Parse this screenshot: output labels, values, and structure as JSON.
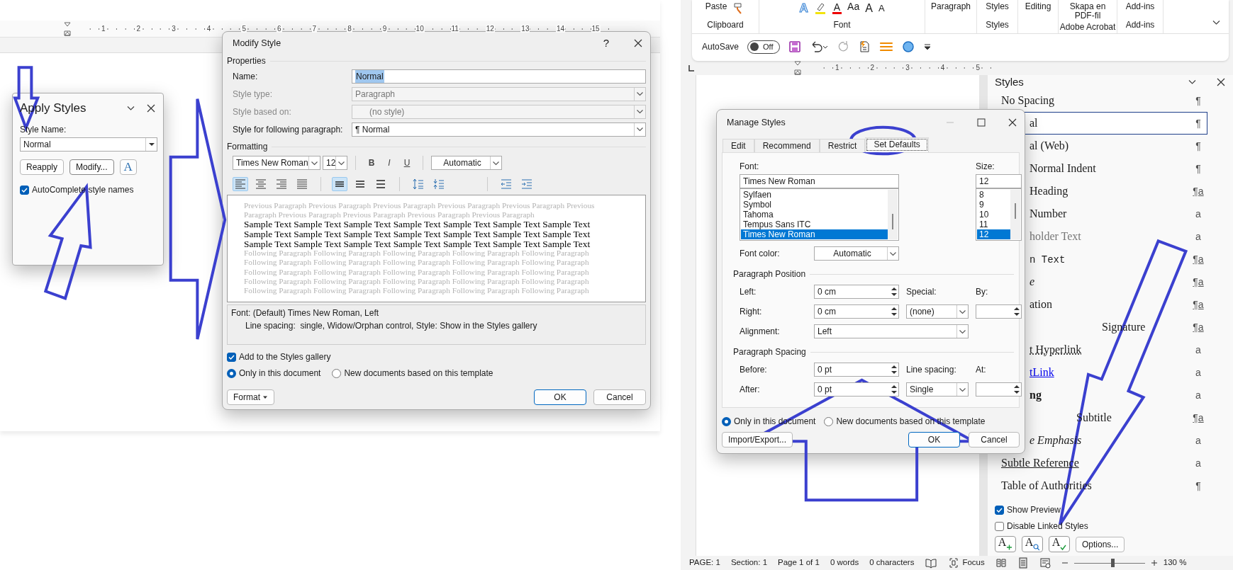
{
  "left_view": {
    "ruler_numbers": [
      "1",
      "2",
      "3",
      "4",
      "5",
      "6",
      "7",
      "8",
      "9",
      "10",
      "11",
      "12",
      "13",
      "14",
      "15"
    ]
  },
  "apply_styles": {
    "title": "Apply Styles",
    "style_name_label": "Style Name:",
    "style_name_value": "Normal",
    "buttons": [
      "Reapply",
      "Modify..."
    ],
    "inspector_letter": "A",
    "autocomplete": {
      "label": "AutoComplete style names",
      "checked": true
    }
  },
  "modify_style": {
    "title": "Modify Style",
    "help": "?",
    "properties_heading": "Properties",
    "fields": [
      {
        "label": "Name:",
        "value": "Normal",
        "kind": "text",
        "disabled": false,
        "highlighted": true
      },
      {
        "label": "Style type:",
        "value": "Paragraph",
        "kind": "select",
        "disabled": true
      },
      {
        "label": "Style based on:",
        "value": "(no style)",
        "kind": "select",
        "disabled": true
      },
      {
        "label": "Style for following paragraph:",
        "value": "¶ Normal",
        "kind": "select",
        "disabled": false
      }
    ],
    "formatting_heading": "Formatting",
    "font": "Times New Roman",
    "size": "12",
    "text_buttons": [
      "B",
      "I",
      "U"
    ],
    "color_choice": "Automatic",
    "paragraph_buttons": [
      {
        "kind": "align-left",
        "selected": true
      },
      {
        "kind": "align-center",
        "selected": false
      },
      {
        "kind": "align-right",
        "selected": false
      },
      {
        "kind": "justify",
        "selected": false
      },
      {
        "kind": "single",
        "selected": true
      },
      {
        "kind": "one-half",
        "selected": false
      },
      {
        "kind": "double",
        "selected": false
      },
      {
        "kind": "space-up",
        "selected": false
      },
      {
        "kind": "space-down",
        "selected": false
      },
      {
        "kind": "outdent",
        "selected": false
      },
      {
        "kind": "indent",
        "selected": false
      }
    ],
    "preview": [
      {
        "kind": "previous",
        "text": "Previous Paragraph Previous Paragraph Previous Paragraph Previous Paragraph Previous Paragraph Previous"
      },
      {
        "kind": "previous",
        "text": "Paragraph Previous Paragraph Previous Paragraph Previous Paragraph Previous Paragraph"
      },
      {
        "kind": "sample",
        "text": "Sample Text Sample Text Sample Text Sample Text Sample Text Sample Text Sample Text"
      },
      {
        "kind": "sample",
        "text": "Sample Text Sample Text Sample Text Sample Text Sample Text Sample Text Sample Text"
      },
      {
        "kind": "sample",
        "text": "Sample Text Sample Text Sample Text Sample Text Sample Text Sample Text Sample Text"
      },
      {
        "kind": "following",
        "text": "Following Paragraph Following Paragraph Following Paragraph Following Paragraph Following Paragraph"
      },
      {
        "kind": "following",
        "text": "Following Paragraph Following Paragraph Following Paragraph Following Paragraph Following Paragraph"
      },
      {
        "kind": "following",
        "text": "Following Paragraph Following Paragraph Following Paragraph Following Paragraph Following Paragraph"
      },
      {
        "kind": "following",
        "text": "Following Paragraph Following Paragraph Following Paragraph Following Paragraph Following Paragraph"
      },
      {
        "kind": "following",
        "text": "Following Paragraph Following Paragraph Following Paragraph Following Paragraph Following Paragraph"
      }
    ],
    "description": [
      "Font: (Default) Times New Roman, Left",
      "Line spacing:  single, Widow/Orphan control, Style: Show in the Styles gallery"
    ],
    "add_to_gallery": {
      "label": "Add to the Styles gallery",
      "checked": true
    },
    "scope": [
      {
        "label": "Only in this document",
        "selected": true
      },
      {
        "label": "New documents based on this template",
        "selected": false
      }
    ],
    "format_button": "Format",
    "ok": "OK",
    "cancel": "Cancel"
  },
  "ribbon": {
    "groups": [
      {
        "label": "Clipboard",
        "buttons": [
          "Paste"
        ]
      },
      {
        "label": "Font",
        "buttons": [
          "Aa"
        ],
        "letters": [
          "A",
          "A",
          "A",
          "A"
        ]
      },
      {
        "buttons": [
          "Paragraph"
        ]
      },
      {
        "label": "Styles",
        "buttons": [
          "Styles"
        ]
      },
      {
        "buttons": [
          "Editing"
        ]
      },
      {
        "label": "Adobe Acrobat",
        "buttons": [
          "Skapa en PDF-fil"
        ]
      },
      {
        "label": "Add-ins",
        "buttons": [
          "Add-ins"
        ]
      }
    ],
    "autosave_label": "AutoSave",
    "autosave": {
      "on": false,
      "label": "Off"
    }
  },
  "right_ruler_numbers": [
    "1",
    "2",
    "3",
    "4",
    "5"
  ],
  "manage_styles": {
    "title": "Manage Styles",
    "tabs": [
      {
        "label": "Edit",
        "selected": false
      },
      {
        "label": "Recommend",
        "selected": false
      },
      {
        "label": "Restrict",
        "selected": false
      },
      {
        "label": "Set Defaults",
        "selected": true
      }
    ],
    "font_label": "Font:",
    "font_value": "Times New Roman",
    "fonts": [
      {
        "label": "Sylfaen",
        "selected": false
      },
      {
        "label": "Symbol",
        "selected": false
      },
      {
        "label": "Tahoma",
        "selected": false
      },
      {
        "label": "Tempus Sans ITC",
        "selected": false
      },
      {
        "label": "Times New Roman",
        "selected": true
      }
    ],
    "size_label": "Size:",
    "size_value": "12",
    "sizes": [
      {
        "label": "8",
        "selected": false
      },
      {
        "label": "9",
        "selected": false
      },
      {
        "label": "10",
        "selected": false
      },
      {
        "label": "11",
        "selected": false
      },
      {
        "label": "12",
        "selected": true
      }
    ],
    "font_color_label": "Font color:",
    "font_color": "Automatic",
    "position_heading": "Paragraph Position",
    "left_label": "Left:",
    "left_value": "0 cm",
    "special_label": "Special:",
    "by_label": "By:",
    "right_label": "Right:",
    "right_value": "0 cm",
    "special_value": "(none)",
    "alignment_label": "Alignment:",
    "alignment_value": "Left",
    "spacing_heading": "Paragraph Spacing",
    "before_label": "Before:",
    "before_value": "0 pt",
    "line_spacing_label": "Line spacing:",
    "at_label": "At:",
    "after_label": "After:",
    "after_value": "0 pt",
    "line_spacing_value": "Single",
    "scope": [
      {
        "label": "Only in this document",
        "selected": true
      },
      {
        "label": "New documents based on this template",
        "selected": false
      }
    ],
    "import_export": "Import/Export...",
    "ok": "OK",
    "cancel": "Cancel"
  },
  "styles_pane": {
    "title": "Styles",
    "items": [
      {
        "name": "No Spacing",
        "marker": "¶",
        "kind": "plain",
        "covered": false,
        "selected": false
      },
      {
        "name": "al",
        "marker": "¶",
        "kind": "plain",
        "covered": true,
        "selected": true
      },
      {
        "name": "al (Web)",
        "marker": "¶",
        "kind": "plain",
        "covered": true,
        "selected": false
      },
      {
        "name": "Normal Indent",
        "marker": "¶",
        "kind": "plain",
        "covered": true,
        "selected": false
      },
      {
        "name": "Heading",
        "marker": "¶a",
        "kind": "plain",
        "covered": true,
        "selected": false
      },
      {
        "name": "Number",
        "marker": "a",
        "kind": "plain",
        "covered": true,
        "selected": false
      },
      {
        "name": "holder Text",
        "marker": "a",
        "kind": "grey",
        "covered": true,
        "selected": false
      },
      {
        "name": "n Text",
        "marker": "¶a",
        "kind": "mono",
        "covered": true,
        "selected": false
      },
      {
        "name": "e",
        "marker": "¶a",
        "kind": "italic",
        "covered": true,
        "selected": false
      },
      {
        "name": "ation",
        "marker": "¶a",
        "kind": "plain",
        "covered": true,
        "selected": false
      },
      {
        "name": "Signature",
        "marker": "¶a",
        "kind": "signature",
        "covered": true,
        "selected": false
      },
      {
        "name": "t Hyperlink",
        "marker": "a",
        "kind": "dotted",
        "covered": true,
        "selected": false
      },
      {
        "name": "tLink",
        "marker": "a",
        "kind": "link",
        "covered": true,
        "selected": false
      },
      {
        "name": "ng",
        "marker": "a",
        "kind": "bold",
        "covered": true,
        "selected": false
      },
      {
        "name": "Subtitle",
        "marker": "¶a",
        "kind": "subtitle",
        "covered": true,
        "selected": false
      },
      {
        "name": "e Emphasis",
        "marker": "a",
        "kind": "italic",
        "covered": true,
        "selected": false
      },
      {
        "name": "Subtle Reference",
        "marker": "a",
        "kind": "underline",
        "covered": false,
        "selected": false
      },
      {
        "name": "Table of Authorities",
        "marker": "¶",
        "kind": "plain",
        "covered": false,
        "selected": false
      }
    ],
    "show_preview": {
      "label": "Show Preview",
      "checked": true
    },
    "disable_linked": {
      "label": "Disable Linked Styles",
      "checked": false
    },
    "button_letters": [
      "A",
      "A",
      "A"
    ],
    "options": "Options..."
  },
  "status_bar": {
    "items": [
      "PAGE: 1",
      "Section: 1",
      "Page 1 of 1",
      "0 words",
      "0 characters"
    ],
    "focus": "Focus",
    "zoom": {
      "level": 0.54,
      "reading": "130 %"
    }
  }
}
